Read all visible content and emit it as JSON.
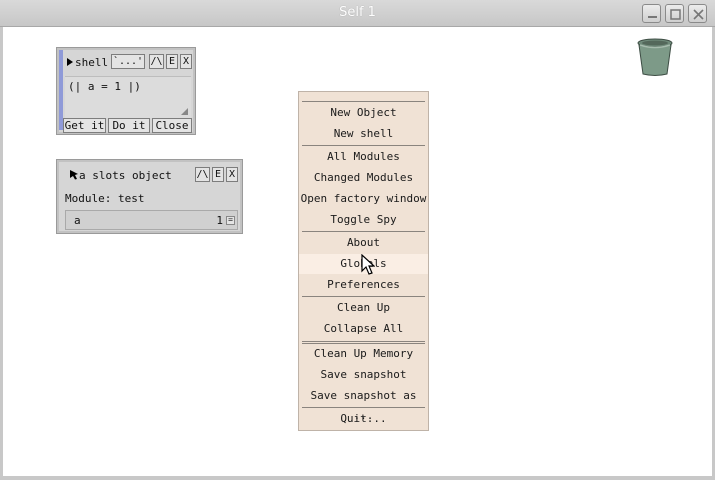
{
  "window": {
    "title": "Self 1",
    "controls": [
      "minimize-icon",
      "maximize-icon",
      "close-icon"
    ]
  },
  "shell_outliner": {
    "title": "shell",
    "header_buttons": [
      "`...'",
      "/\\",
      "E",
      "X"
    ],
    "code": "(| a = 1 |)",
    "action_buttons": [
      "Get it",
      "Do it",
      "Close"
    ]
  },
  "slots_outliner": {
    "title": "a slots object",
    "header_buttons": [
      "/\\",
      "E",
      "X"
    ],
    "module_label": "Module: test",
    "slot": {
      "name": "a",
      "value": "1"
    }
  },
  "menu": {
    "items": [
      "New Object",
      "New shell",
      "All Modules",
      "Changed Modules",
      "Open factory window",
      "Toggle Spy",
      "About",
      "Globals",
      "Preferences",
      "Clean Up",
      "Collapse All",
      "Clean Up Memory",
      "Save snapshot",
      "Save snapshot as ...",
      "Quit..."
    ],
    "highlighted": "Globals"
  },
  "colors": {
    "menu_bg": "#f0e2d5",
    "outliner_bg": "#d6d6d6",
    "shell_accent": "#8f9ad8",
    "trash": "#7d9a88"
  }
}
